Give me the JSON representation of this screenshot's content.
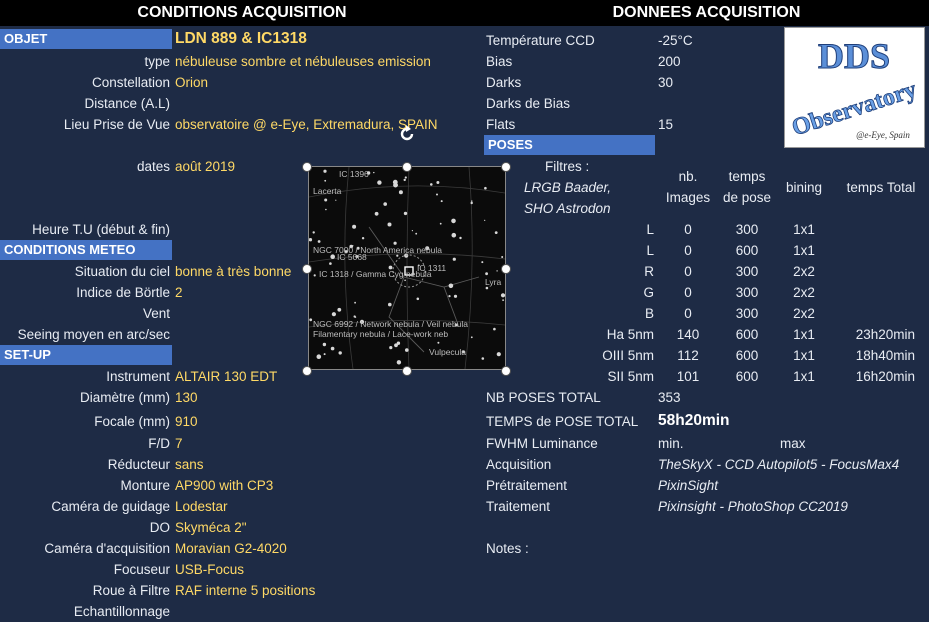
{
  "headers": {
    "left": "CONDITIONS ACQUISITION",
    "right": "DONNEES ACQUISITION"
  },
  "objet": {
    "section": "OBJET",
    "title": "LDN 889 & IC1318",
    "rows": [
      {
        "label": "type",
        "value": "nébuleuse sombre et nébuleuses  emission"
      },
      {
        "label": "Constellation",
        "value": "Orion"
      },
      {
        "label": "Distance (A.L)",
        "value": ""
      },
      {
        "label": "Lieu Prise de Vue",
        "value": "observatoire @ e-Eye, Extremadura, SPAIN"
      },
      {
        "label": "dates",
        "value": "août 2019"
      },
      {
        "label": "Heure T.U (début & fin)",
        "value": ""
      }
    ]
  },
  "meteo": {
    "section": "CONDITIONS METEO",
    "rows": [
      {
        "label": "Situation du ciel",
        "value": "bonne à très bonne"
      },
      {
        "label": "Indice de Börtle",
        "value": "2"
      },
      {
        "label": "Vent",
        "value": ""
      },
      {
        "label": "Seeing moyen en arc/sec",
        "value": ""
      }
    ]
  },
  "setup": {
    "section": "SET-UP",
    "rows": [
      {
        "label": "Instrument",
        "value": "ALTAIR 130 EDT"
      },
      {
        "label": "Diamètre (mm)",
        "value": "130"
      },
      {
        "label": "Focale (mm)",
        "value": "910"
      },
      {
        "label": "F/D",
        "value": "7"
      },
      {
        "label": "Réducteur",
        "value": "sans"
      },
      {
        "label": "Monture",
        "value": "AP900 with CP3"
      },
      {
        "label": "Caméra de guidage",
        "value": "Lodestar"
      },
      {
        "label": "DO",
        "value": "Skyméca 2\""
      },
      {
        "label": "Caméra d'acquisition",
        "value": "Moravian G2-4020"
      },
      {
        "label": "Focuseur",
        "value": "USB-Focus"
      },
      {
        "label": "Roue à Filtre",
        "value": "RAF interne 5 positions"
      },
      {
        "label": "Echantillonnage",
        "value": ""
      }
    ]
  },
  "donnees": {
    "rows": [
      {
        "label": "Température CCD",
        "value": "-25°C"
      },
      {
        "label": "Bias",
        "value": "200"
      },
      {
        "label": "Darks",
        "value": "30"
      },
      {
        "label": "Darks de Bias",
        "value": ""
      },
      {
        "label": "Flats",
        "value": "15"
      }
    ]
  },
  "poses": {
    "section": "POSES",
    "filtres_label": "Filtres :",
    "filtres_lines": [
      "LRGB Baader,",
      "SHO Astrodon"
    ],
    "col_nb": [
      "nb.",
      "Images"
    ],
    "col_temps": [
      "temps",
      "de pose"
    ],
    "col_bining": "bining",
    "col_total": "temps Total",
    "rows": [
      {
        "filter": "L",
        "nb": "0",
        "temps": "300",
        "bin": "1x1",
        "total": ""
      },
      {
        "filter": "L",
        "nb": "0",
        "temps": "600",
        "bin": "1x1",
        "total": ""
      },
      {
        "filter": "R",
        "nb": "0",
        "temps": "300",
        "bin": "2x2",
        "total": ""
      },
      {
        "filter": "G",
        "nb": "0",
        "temps": "300",
        "bin": "2x2",
        "total": ""
      },
      {
        "filter": "B",
        "nb": "0",
        "temps": "300",
        "bin": "2x2",
        "total": ""
      },
      {
        "filter": "Ha 5nm",
        "nb": "140",
        "temps": "600",
        "bin": "1x1",
        "total": "23h20min"
      },
      {
        "filter": "OIII 5nm",
        "nb": "112",
        "temps": "600",
        "bin": "1x1",
        "total": "18h40min"
      },
      {
        "filter": "SII 5nm",
        "nb": "101",
        "temps": "600",
        "bin": "1x1",
        "total": "16h20min"
      }
    ]
  },
  "totals": {
    "nb_label": "NB POSES TOTAL",
    "nb_value": "353",
    "temps_label": "TEMPS de POSE TOTAL",
    "temps_value": "58h20min",
    "fwhm_label": "FWHM Luminance",
    "fwhm_min": "min.",
    "fwhm_max": "max",
    "acq_label": "Acquisition",
    "acq_value": "TheSkyX - CCD Autopilot5 - FocusMax4",
    "pre_label": "Prétraitement",
    "pre_value": "PixinSight",
    "trait_label": "Traitement",
    "trait_value": "Pixinsight - PhotoShop CC2019",
    "notes_label": "Notes :"
  },
  "logo": {
    "line1": "DDS",
    "line2": "Observatory",
    "line3": "@e-Eye, Spain"
  },
  "map": {
    "labels": [
      "IC 1396",
      "Lacerta",
      "NGC 7000 / North America nebula",
      "IC 5068",
      "IC 1318 / Gamma Cyg nebula",
      "IC 1311",
      "Lyra",
      "NGC 6992 / Network nebula / Veil nebula",
      "Filamentary nebula / Lace-work neb",
      "Vulpecula"
    ]
  },
  "colors": {
    "background": "#1e2b45",
    "section": "#4472c4",
    "highlight": "#ffd966"
  }
}
